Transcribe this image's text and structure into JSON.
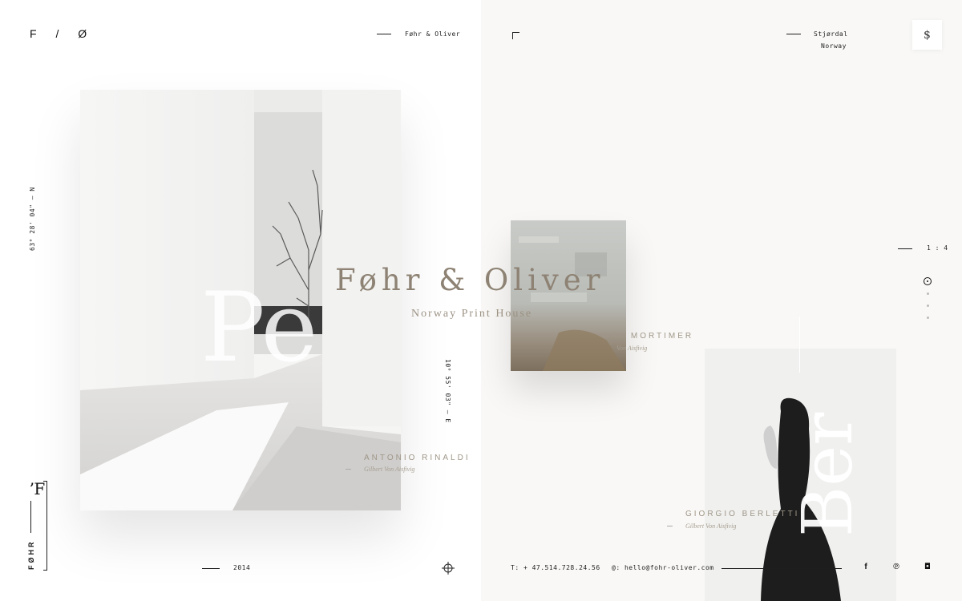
{
  "header": {
    "logo": "F / Ø",
    "brand": "Føhr & Oliver",
    "location_city": "Stjørdal",
    "location_country": "Norway",
    "menu_icon": "dollar-s-glyph",
    "menu_glyph": "$"
  },
  "hero": {
    "title": "Føhr & Oliver",
    "subtitle": "Norway Print House"
  },
  "coordinates": {
    "north": "63° 28' 04\" — N",
    "east": "10° 55' 03\" — E"
  },
  "captions": [
    {
      "name": "ANTONIO RINALDI",
      "subtitle": "Gilbert Von Aisfivig"
    },
    {
      "name": "OAK MORTIMER",
      "subtitle": "Von Aisfivig"
    },
    {
      "name": "GIORGIO BERLETTI",
      "subtitle": "Gilbert Von Aisfivig"
    }
  ],
  "slider": {
    "ratio": "1 : 4",
    "current": 1,
    "total": 4
  },
  "side_brand": {
    "vertical_text": "FØHR",
    "glyph": "ʼF"
  },
  "overlay_letters": {
    "left": "Pe",
    "right": "Ber"
  },
  "footer": {
    "year": "2014",
    "phone": "T: + 47.514.728.24.56",
    "email": "@: hello@fohr-oliver.com",
    "social": [
      {
        "icon": "facebook-icon",
        "glyph": "f"
      },
      {
        "icon": "pinterest-icon",
        "glyph": "℗"
      },
      {
        "icon": "instagram-icon",
        "glyph": "◘"
      }
    ]
  },
  "colors": {
    "accent": "#8d8273",
    "text": "#1e1e1e",
    "right_panel_bg": "#f9f8f6"
  }
}
